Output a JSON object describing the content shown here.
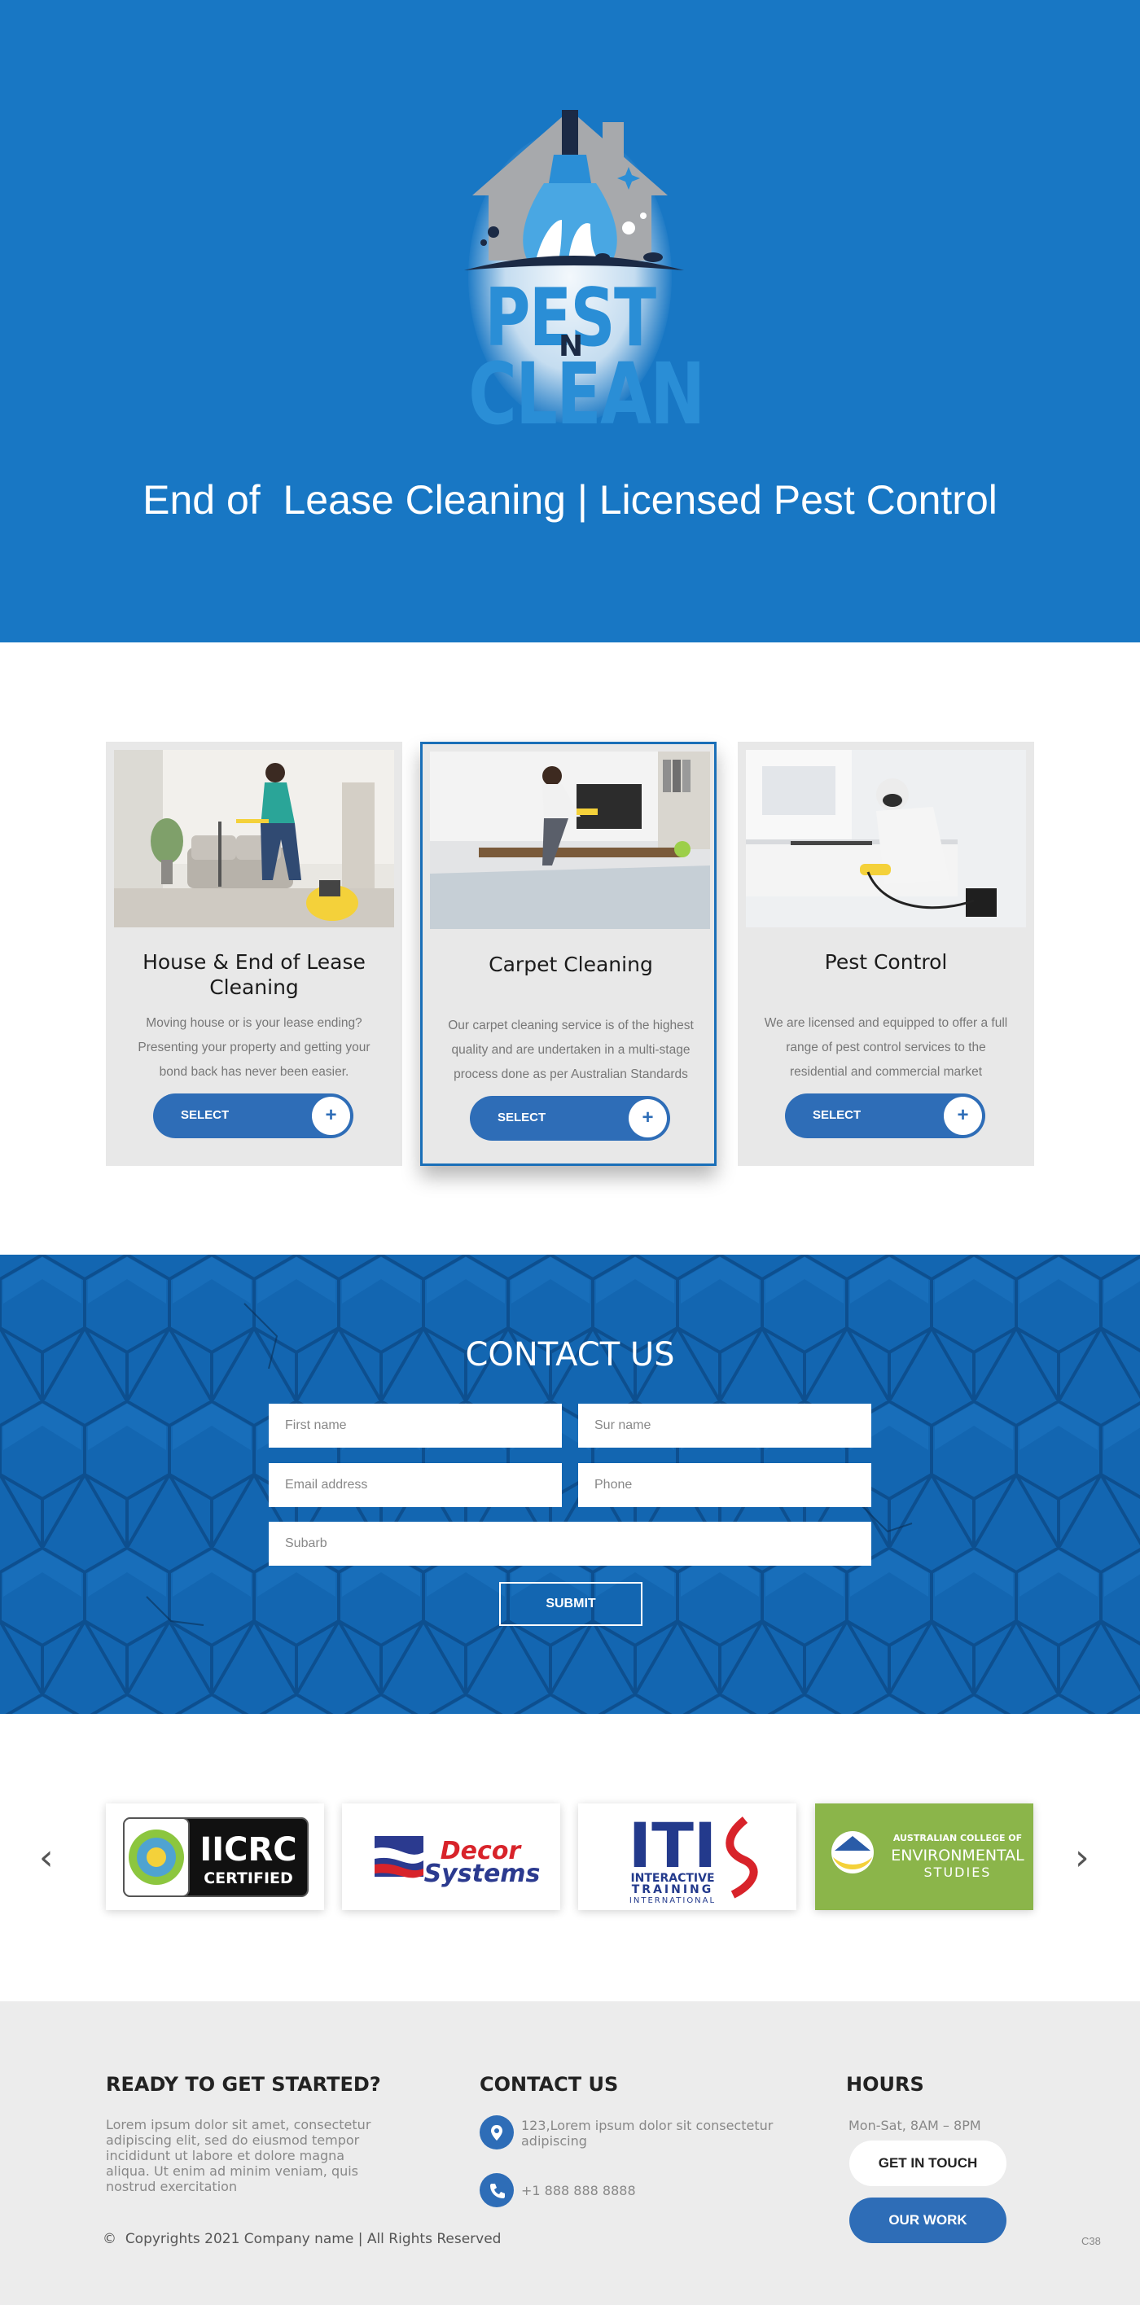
{
  "hero": {
    "logo_line1": "PEST",
    "logo_n": "N",
    "logo_line2": "CLEAN",
    "title": "End of  Lease Cleaning | Licensed Pest Control"
  },
  "services": [
    {
      "title": "House & End of Lease Cleaning",
      "text": "Moving house or is your lease ending? Presenting your property and getting your bond back has never been easier.",
      "button": "SELECT",
      "plus": "+"
    },
    {
      "title": "Carpet Cleaning",
      "text": "Our carpet cleaning service is of the highest quality and are undertaken in a multi-stage process done as per Australian Standards",
      "button": "SELECT",
      "plus": "+"
    },
    {
      "title": "Pest Control",
      "text": "We are licensed and equipped to offer a full range of pest control services to the residential and commercial market",
      "button": "SELECT",
      "plus": "+"
    }
  ],
  "contact": {
    "title": "CONTACT US",
    "first_name_placeholder": "First name",
    "sur_name_placeholder": "Sur name",
    "email_placeholder": "Email address",
    "phone_placeholder": "Phone",
    "suburb_placeholder": "Subarb",
    "submit": "SUBMIT"
  },
  "partners": {
    "prev_icon": "chevron-left-icon",
    "next_icon": "chevron-right-icon",
    "iicrc_line1": "IICRC",
    "iicrc_line2": "CERTIFIED",
    "decor_line1": "Decor",
    "decor_line2": "Systems",
    "iti_big": "ITI",
    "iti_line1": "INTERACTIVE",
    "iti_line2": "TRAINING",
    "iti_line3": "INTERNATIONAL",
    "aces_line1": "AUSTRALIAN COLLEGE OF",
    "aces_line2": "ENVIRONMENTAL",
    "aces_line3": "STUDIES"
  },
  "footer": {
    "col1_title": "READY TO GET STARTED?",
    "col1_text": "Lorem ipsum dolor sit amet, consectetur adipiscing elit, sed do eiusmod tempor incididunt ut labore et dolore magna aliqua. Ut enim ad minim veniam, quis nostrud exercitation",
    "col2_title": "CONTACT US",
    "address": "123,Lorem ipsum dolor sit consectetur adipiscing",
    "phone": "+1 888 888 8888",
    "col3_title": "HOURS",
    "hours": "Mon-Sat, 8AM – 8PM",
    "get_in_touch": "GET IN TOUCH",
    "our_work": "OUR WORK",
    "copyright": "Copyrights 2021 Company name | All Rights Reserved",
    "copyright_symbol": "©",
    "badge": "C38"
  },
  "colors": {
    "primary": "#1877c4",
    "contact_bg": "#1366b1",
    "button": "#2e6db7",
    "card_bg": "#e8e8e8",
    "footer_bg": "#ececec"
  }
}
